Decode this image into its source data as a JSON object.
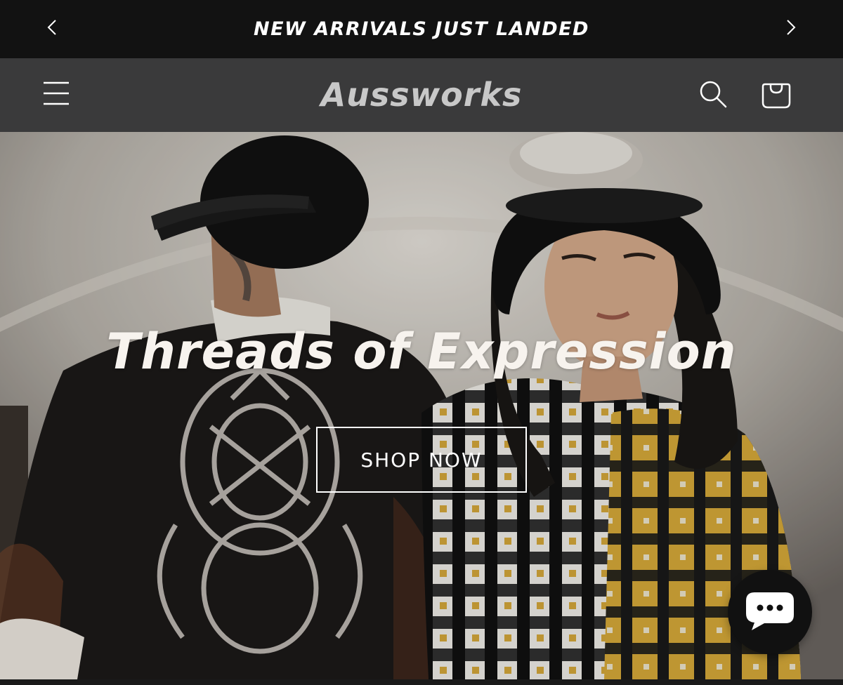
{
  "announcement": {
    "text": "NEW ARRIVALS JUST LANDED",
    "prev_icon": "chevron-left-icon",
    "next_icon": "chevron-right-icon"
  },
  "header": {
    "logo_text": "Aussworks",
    "menu_icon": "hamburger-menu-icon",
    "search_icon": "search-icon",
    "cart_icon": "shopping-bag-icon"
  },
  "hero": {
    "heading": "Threads of Expression",
    "cta_label": "SHOP NOW"
  },
  "chat": {
    "icon": "chat-bubble-icon"
  },
  "colors": {
    "announcement_bg": "#121212",
    "header_bg": "#3a3a3b",
    "logo": "#c8c8c8",
    "hero_text": "#f7f3ee",
    "chat_bg": "#111111"
  }
}
